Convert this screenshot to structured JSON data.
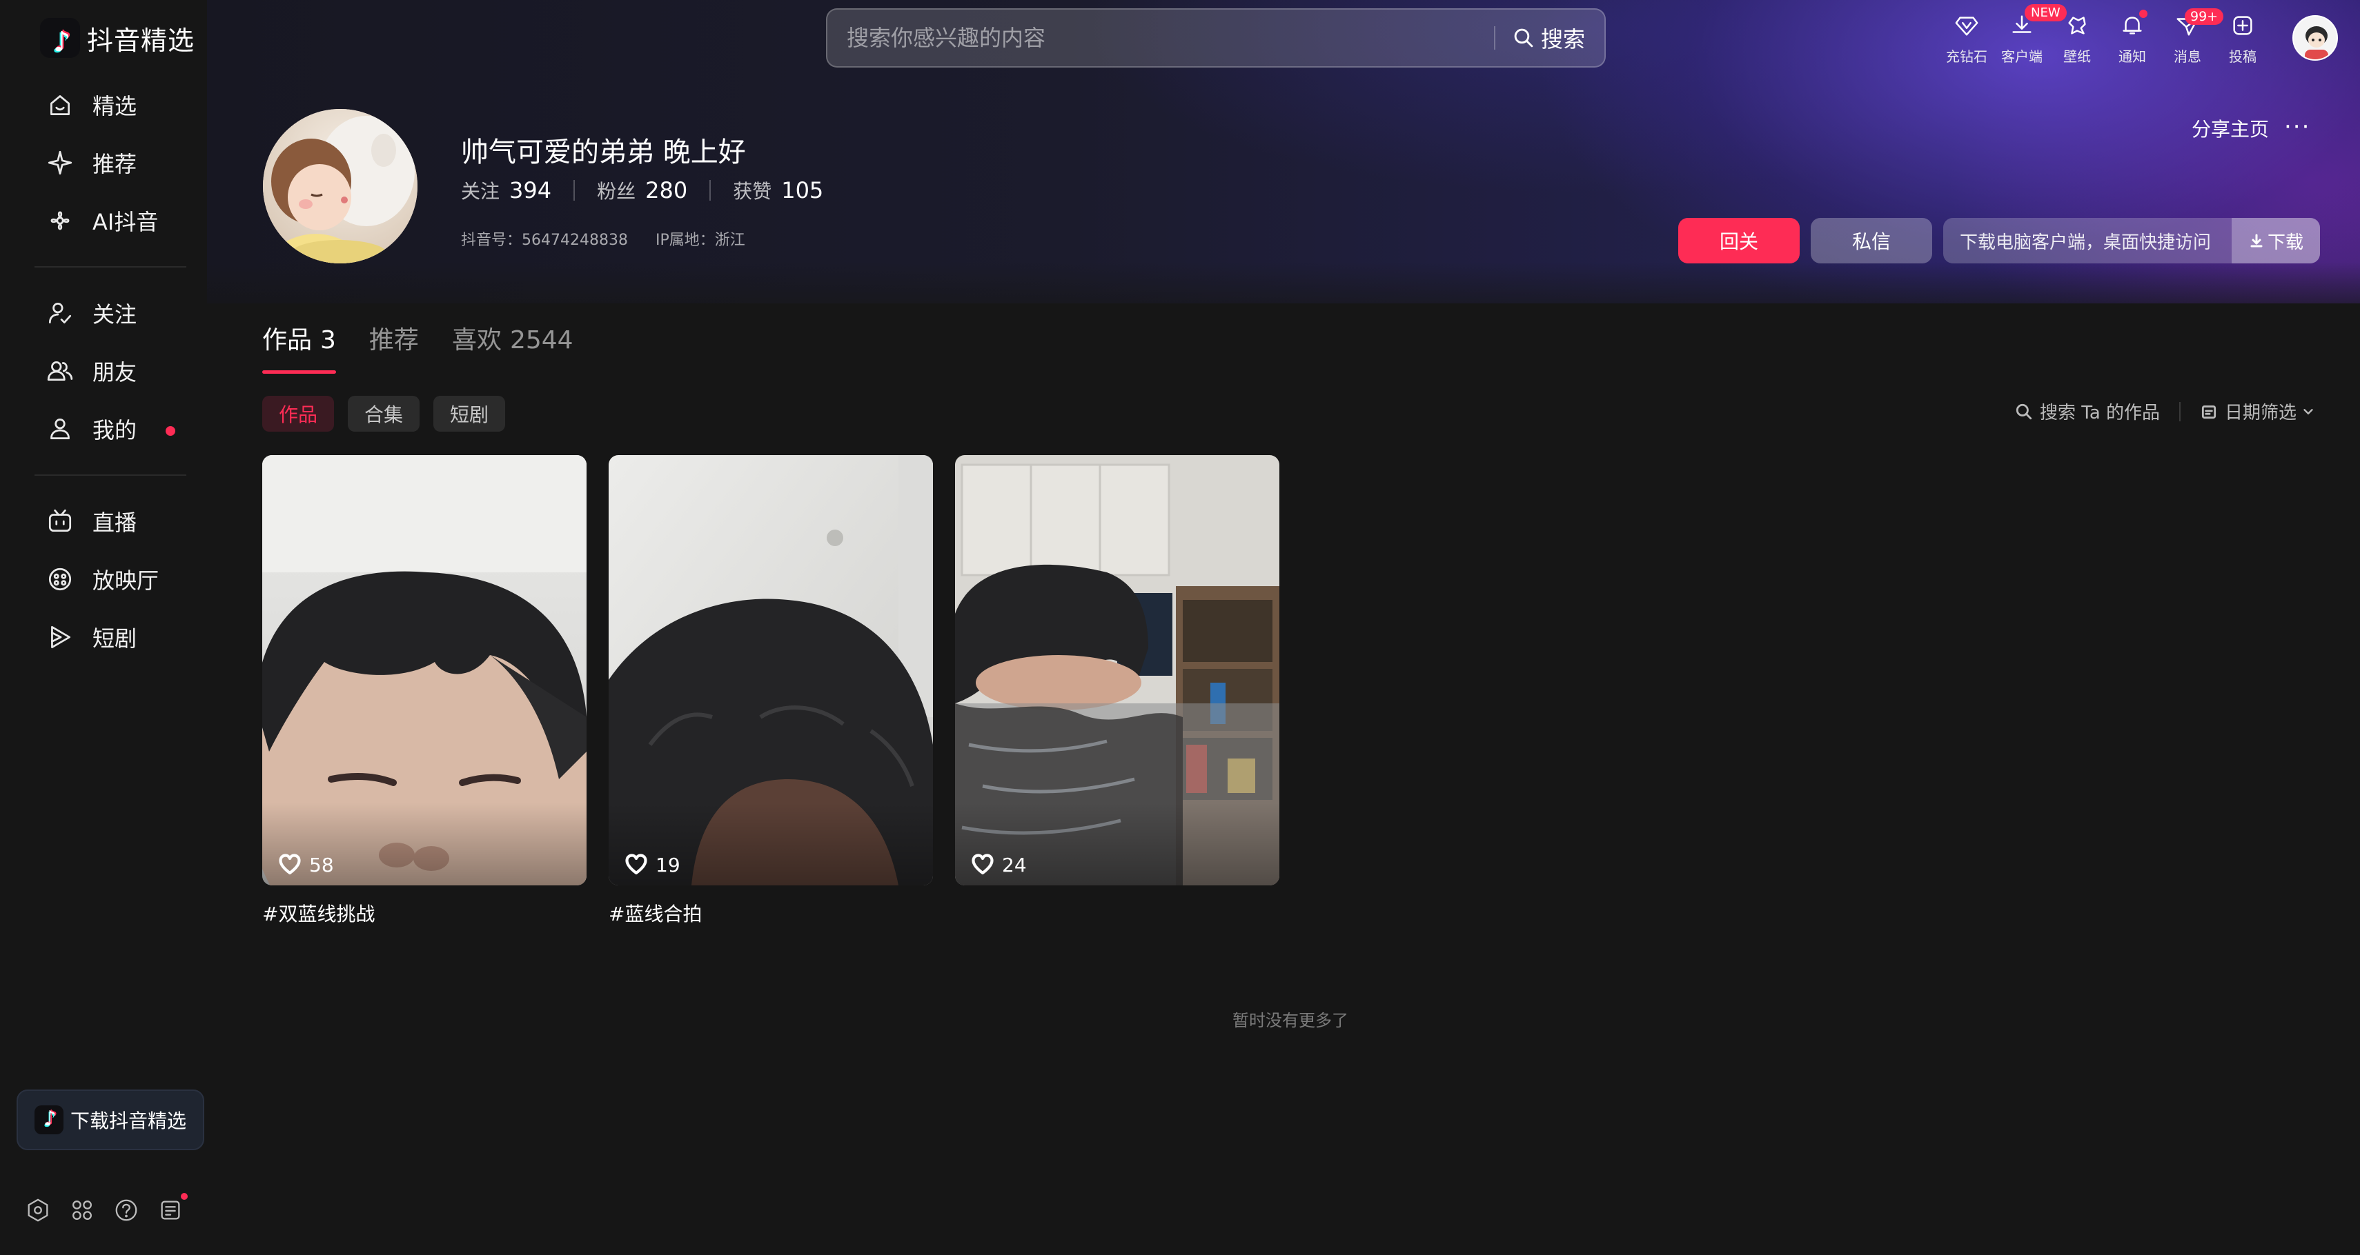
{
  "app": {
    "name": "抖音精选"
  },
  "sidebar": {
    "items": [
      {
        "label": "精选",
        "icon": "home-smile-icon"
      },
      {
        "label": "推荐",
        "icon": "sparkle-icon"
      },
      {
        "label": "AI抖音",
        "icon": "ai-flower-icon"
      },
      {
        "label": "关注",
        "icon": "follow-person-check-icon"
      },
      {
        "label": "朋友",
        "icon": "friends-icon"
      },
      {
        "label": "我的",
        "icon": "person-icon",
        "dot": true
      },
      {
        "label": "直播",
        "icon": "live-tv-icon"
      },
      {
        "label": "放映厅",
        "icon": "cinema-reel-icon"
      },
      {
        "label": "短剧",
        "icon": "short-drama-play-icon"
      }
    ],
    "download_label": "下载抖音精选",
    "bottom_icons": [
      "settings-icon",
      "apps-grid-icon",
      "help-icon",
      "feedback-note-icon"
    ]
  },
  "search": {
    "placeholder": "搜索你感兴趣的内容",
    "button_label": "搜索"
  },
  "top_actions": [
    {
      "label": "充钻石",
      "icon": "diamond-icon"
    },
    {
      "label": "客户端",
      "icon": "download-client-icon",
      "badge": "NEW"
    },
    {
      "label": "壁纸",
      "icon": "wallpaper-icon"
    },
    {
      "label": "通知",
      "icon": "bell-icon",
      "dot": true
    },
    {
      "label": "消息",
      "icon": "message-send-icon",
      "badge": "99+"
    },
    {
      "label": "投稿",
      "icon": "upload-plus-icon"
    }
  ],
  "profile": {
    "name": "帅气可爱的弟弟 晚上好",
    "stats": [
      {
        "label": "关注",
        "value": "394"
      },
      {
        "label": "粉丝",
        "value": "280"
      },
      {
        "label": "获赞",
        "value": "105"
      }
    ],
    "douyin_id": "抖音号：56474248838",
    "ip": "IP属地：浙江",
    "share_label": "分享主页",
    "more_label": "···"
  },
  "actions": {
    "follow_back": "回关",
    "message": "私信",
    "download_hint": "下载电脑客户端，桌面快捷访问",
    "download_btn": "下载"
  },
  "tabs": [
    {
      "label": "作品",
      "count": "3",
      "active": true
    },
    {
      "label": "推荐",
      "count": ""
    },
    {
      "label": "喜欢",
      "count": "2544"
    }
  ],
  "chips": [
    {
      "label": "作品",
      "active": true
    },
    {
      "label": "合集"
    },
    {
      "label": "短剧"
    }
  ],
  "filters": {
    "search_label": "搜索 Ta 的作品",
    "date_label": "日期筛选"
  },
  "videos": [
    {
      "likes": "58",
      "caption": "#双蓝线挑战"
    },
    {
      "likes": "19",
      "caption": "#蓝线合拍"
    },
    {
      "likes": "24",
      "caption": ""
    }
  ],
  "footer_text": "暂时没有更多了",
  "colors": {
    "accent": "#fe2c55",
    "background": "#161616"
  }
}
